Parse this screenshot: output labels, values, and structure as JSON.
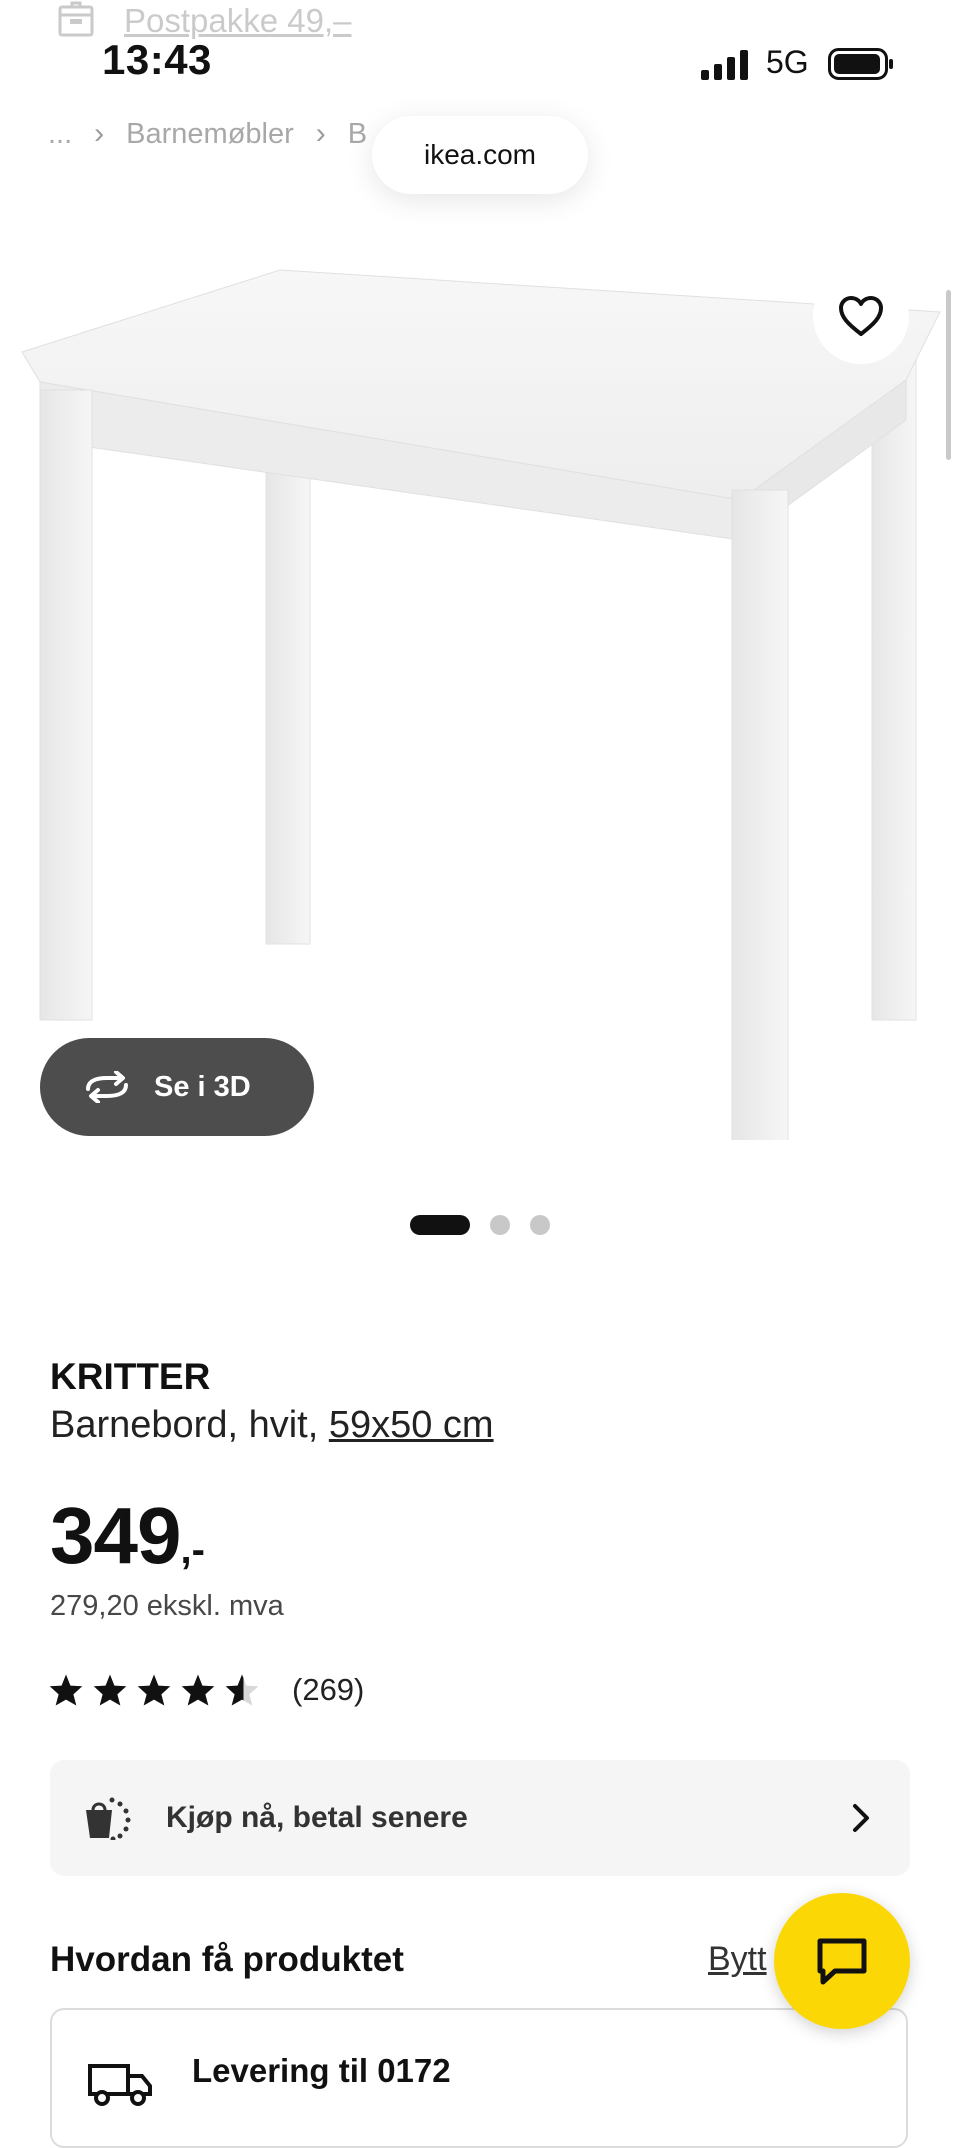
{
  "status_bar": {
    "time": "13:43",
    "network": "5G"
  },
  "promo": {
    "text": "Postpakke 49,–",
    "icon": "package-icon"
  },
  "breadcrumb": {
    "ellipsis": "...",
    "items": [
      "Barnemøbler",
      "B"
    ]
  },
  "browser": {
    "url": "ikea.com"
  },
  "gallery": {
    "view_3d_label": "Se i 3D",
    "dots": {
      "count": 3,
      "active_index": 0
    },
    "favorite_icon": "heart-icon"
  },
  "product": {
    "name": "KRITTER",
    "description_prefix": "Barnebord, hvit, ",
    "size": "59x50 cm",
    "price_integer": "349",
    "price_suffix": ",-",
    "price_ex_vat": "279,20 ekskl. mva",
    "rating": {
      "value": 4.5,
      "max": 5,
      "count": "(269)"
    }
  },
  "pay_later": {
    "label": "Kjøp nå, betal senere",
    "icon": "shopping-bag-icon",
    "chevron": "chevron-right-icon"
  },
  "delivery_section": {
    "title": "Hvordan få produktet",
    "change_link": "Bytt",
    "delivery_option": "Levering til 0172"
  },
  "chat": {
    "icon": "chat-icon"
  },
  "colors": {
    "accent_yellow": "#fcd706",
    "dark_button": "#4d4d4d",
    "text": "#111111"
  }
}
